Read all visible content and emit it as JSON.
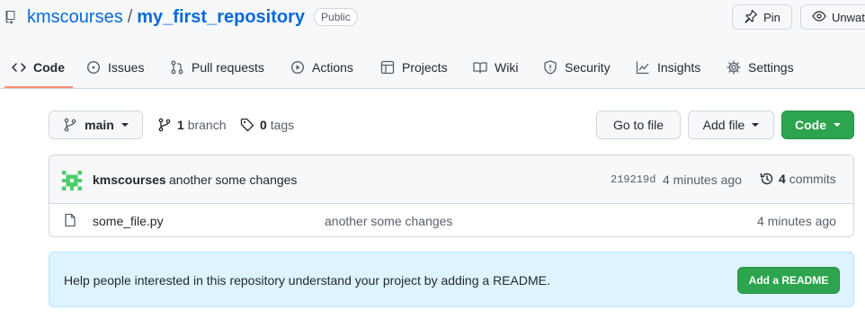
{
  "repo": {
    "owner": "kmscourses",
    "separator": "/",
    "name": "my_first_repository",
    "visibility": "Public"
  },
  "actions": {
    "pin_label": "Pin",
    "unwatch_label": "Unwatch"
  },
  "tabs": [
    {
      "label": "Code",
      "icon": "code-icon",
      "active": true
    },
    {
      "label": "Issues",
      "icon": "issue-icon"
    },
    {
      "label": "Pull requests",
      "icon": "pull-request-icon"
    },
    {
      "label": "Actions",
      "icon": "play-icon"
    },
    {
      "label": "Projects",
      "icon": "table-icon"
    },
    {
      "label": "Wiki",
      "icon": "book-icon"
    },
    {
      "label": "Security",
      "icon": "shield-icon"
    },
    {
      "label": "Insights",
      "icon": "graph-icon"
    },
    {
      "label": "Settings",
      "icon": "gear-icon"
    }
  ],
  "toolbar": {
    "branch_label": "main",
    "branch_count": "1",
    "branch_word": "branch",
    "tag_count": "0",
    "tag_word": "tags",
    "go_to_file_label": "Go to file",
    "add_file_label": "Add file",
    "code_label": "Code"
  },
  "commit": {
    "author": "kmscourses",
    "message": "another some changes",
    "sha": "219219d",
    "time": "4 minutes ago",
    "commit_count": "4",
    "commit_word": "commits"
  },
  "files": [
    {
      "name": "some_file.py",
      "message": "another some changes",
      "time": "4 minutes ago"
    }
  ],
  "readme": {
    "text": "Help people interested in this repository understand your project by adding a README.",
    "button_label": "Add a README"
  },
  "colors": {
    "link": "#0969da",
    "green": "#2da44e",
    "tab_underline": "#fd8c73",
    "readme_bg": "#ddf4ff"
  }
}
